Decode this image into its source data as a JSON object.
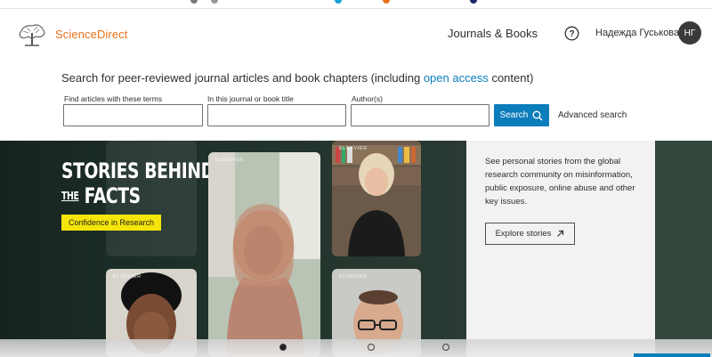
{
  "header": {
    "logo_text": "ScienceDirect",
    "nav_journals": "Journals & Books",
    "help_icon": "help-circle-icon",
    "user_name": "Надежда Гуськова",
    "avatar_initials": "НГ"
  },
  "search": {
    "heading_prefix": "Search for peer-reviewed journal articles and book chapters (including ",
    "heading_link": "open access",
    "heading_suffix": " content)",
    "fields": [
      {
        "label": "Find articles with these terms",
        "value": ""
      },
      {
        "label": "In this journal or book title",
        "value": ""
      },
      {
        "label": "Author(s)",
        "value": ""
      }
    ],
    "button_label": "Search",
    "advanced_label": "Advanced search"
  },
  "banner": {
    "title_line1": "STORIES BEHIND",
    "title_the": "THE",
    "title_line2": "FACTS",
    "tag": "Confidence in Research",
    "panel_text": "See personal stories from the global research community on misinformation, public exposure, online abuse and other key issues.",
    "explore_label": "Explore stories",
    "photo_badge": "ELSEVIER"
  },
  "carousel": {
    "active_index": 0,
    "dot_count": 3
  },
  "colors": {
    "brand_orange": "#e9711c",
    "primary_blue": "#0c7dbb",
    "banner_dark": "#1f2e28",
    "tag_yellow": "#f5e50b"
  }
}
